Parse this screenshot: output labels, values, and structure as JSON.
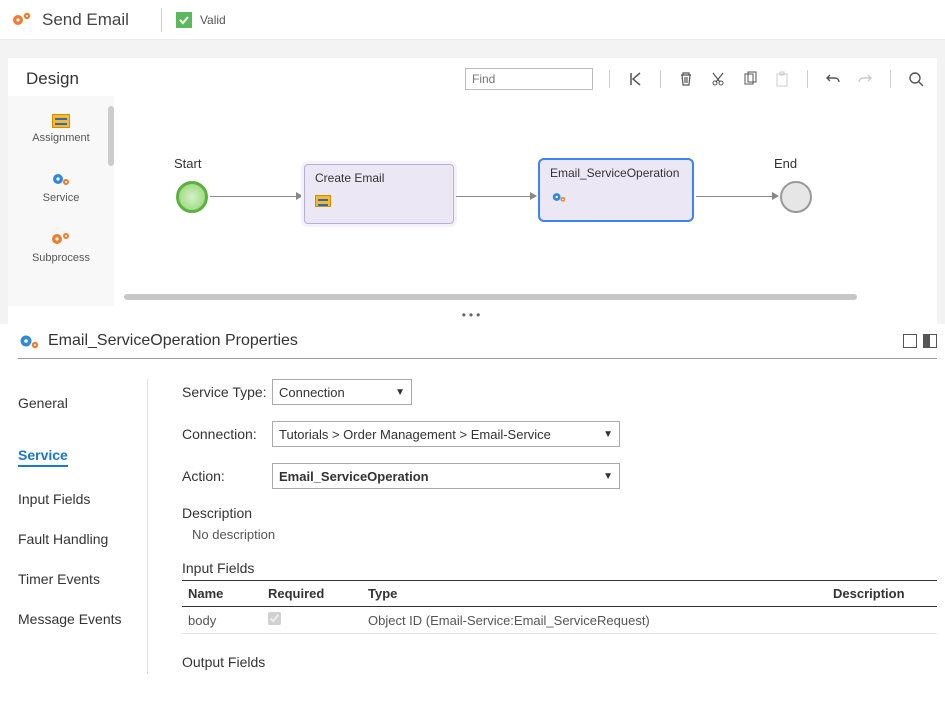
{
  "header": {
    "title": "Send Email",
    "valid_label": "Valid"
  },
  "design": {
    "title": "Design",
    "find_placeholder": "Find",
    "palette": [
      {
        "label": "Assignment",
        "icon": "assignment-icon"
      },
      {
        "label": "Service",
        "icon": "service-gears-icon"
      },
      {
        "label": "Subprocess",
        "icon": "subprocess-gears-icon"
      }
    ],
    "flow": {
      "start_label": "Start",
      "end_label": "End",
      "nodes": [
        {
          "id": "create_email",
          "title": "Create Email",
          "icon": "assignment-icon"
        },
        {
          "id": "email_service_op",
          "title": "Email_ServiceOperation",
          "icon": "service-gears-icon"
        }
      ]
    }
  },
  "properties": {
    "title": "Email_ServiceOperation Properties",
    "nav": {
      "general": "General",
      "service": "Service",
      "input_fields": "Input Fields",
      "fault_handling": "Fault Handling",
      "timer_events": "Timer Events",
      "message_events": "Message Events"
    },
    "active_nav": "service",
    "form": {
      "service_type_label": "Service Type:",
      "service_type_value": "Connection",
      "connection_label": "Connection:",
      "connection_value": "Tutorials > Order Management > Email-Service",
      "action_label": "Action:",
      "action_value": "Email_ServiceOperation",
      "description_heading": "Description",
      "description_text": "No description",
      "input_fields_heading": "Input Fields",
      "output_fields_heading": "Output Fields",
      "table_headers": {
        "name": "Name",
        "required": "Required",
        "type": "Type",
        "description": "Description"
      },
      "input_rows": [
        {
          "name": "body",
          "required": true,
          "type": "Object ID (Email-Service:Email_ServiceRequest)",
          "description": ""
        }
      ]
    }
  },
  "colors": {
    "accent": "#1976d2",
    "blue_gear": "#2f8bd8",
    "orange_gear": "#ed7d31",
    "valid_green": "#5cb85c",
    "start_green": "#5ab13d",
    "node_bg": "#ece7f5",
    "node_border": "#b9afd4",
    "selected_border": "#3b82f6"
  }
}
